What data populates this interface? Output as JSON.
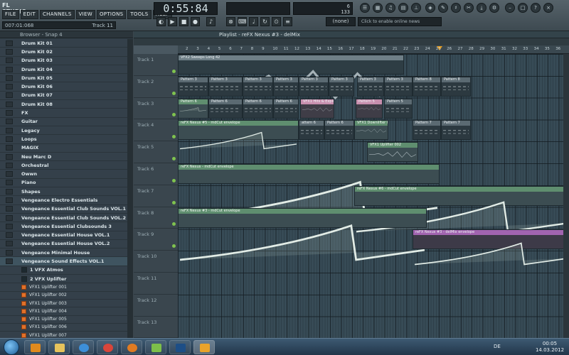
{
  "app": {
    "logo": "FL STUDIO",
    "menu": [
      "FILE",
      "EDIT",
      "CHANNELS",
      "VIEW",
      "OPTIONS",
      "TOOLS",
      "HELP"
    ],
    "hint_time": "007:01:068",
    "hint_track": "Track 11",
    "clock": "0:55:84",
    "cpu_line1": "6",
    "cpu_line2": "133",
    "snap_value": "(none)",
    "online_news": "Click to enable online news"
  },
  "browser": {
    "title": "Browser - Snap 4",
    "folders": [
      {
        "label": "Drum Kit 01"
      },
      {
        "label": "Drum Kit 02"
      },
      {
        "label": "Drum Kit 03"
      },
      {
        "label": "Drum Kit 04"
      },
      {
        "label": "Drum Kit 05"
      },
      {
        "label": "Drum Kit 06"
      },
      {
        "label": "Drum Kit 07"
      },
      {
        "label": "Drum Kit 08"
      },
      {
        "label": "FX"
      },
      {
        "label": "Guitar"
      },
      {
        "label": "Legacy"
      },
      {
        "label": "Loops"
      },
      {
        "label": "MAGIX"
      },
      {
        "label": "Neu Marc D"
      },
      {
        "label": "Orchestral"
      },
      {
        "label": "Owwn"
      },
      {
        "label": "Piano"
      },
      {
        "label": "Shapes"
      },
      {
        "label": "Vengeance Electro Essentials"
      },
      {
        "label": "Vengeance Essential Club Sounds VOL.1"
      },
      {
        "label": "Vengeance Essential Club Sounds VOL.2"
      },
      {
        "label": "Vengeance Essential Clubsounds 3"
      },
      {
        "label": "Vengeance Essential House VOL.1"
      },
      {
        "label": "Vengeance Essential House VOL.2"
      },
      {
        "label": "Vengeance Minimal House"
      },
      {
        "label": "Vengeance Sound Effects VOL.1"
      }
    ],
    "subfolders": [
      "1 VFX Atmos",
      "2 VFX Uplifter"
    ],
    "files": [
      "VFX1 Uplifter 001",
      "VFX1 Uplifter 002",
      "VFX1 Uplifter 003",
      "VFX1 Uplifter 004",
      "VFX1 Uplifter 005",
      "VFX1 Uplifter 006",
      "VFX1 Uplifter 007"
    ]
  },
  "playlist": {
    "title": "Playlist - reFX Nexus #3 - delMix",
    "bars": [
      "2",
      "3",
      "4",
      "5",
      "6",
      "7",
      "8",
      "9",
      "10",
      "11",
      "12",
      "13",
      "14",
      "15",
      "16",
      "17",
      "18",
      "19",
      "20",
      "21",
      "22",
      "23",
      "24",
      "25",
      "26",
      "27",
      "28",
      "29",
      "30",
      "31",
      "32",
      "33",
      "34",
      "35",
      "36"
    ],
    "tracks": [
      "Track 1",
      "Track 2",
      "Track 3",
      "Track 4",
      "Track 5",
      "Track 6",
      "Track 7",
      "Track 8",
      "Track 9",
      "Track 10",
      "Track 11",
      "Track 12",
      "Track 13"
    ],
    "clips": [
      {
        "label": "VFX2 Sweeps Long 42",
        "kind": "aud"
      },
      {
        "label": "Pattern 3",
        "kind": "pat"
      },
      {
        "label": "Pattern 3",
        "kind": "pat"
      },
      {
        "label": "Pattern 3",
        "kind": "pat"
      },
      {
        "label": "Pattern 3",
        "kind": "pat"
      },
      {
        "label": "Pattern 3",
        "kind": "pat"
      },
      {
        "label": "Pattern 3",
        "kind": "pat"
      },
      {
        "label": "Pattern 3",
        "kind": "pat"
      },
      {
        "label": "Pattern 3",
        "kind": "pat"
      },
      {
        "label": "Pattern 8",
        "kind": "pat"
      },
      {
        "label": "Pattern 8",
        "kind": "pat"
      },
      {
        "label": "Pattern 6",
        "kind": "env"
      },
      {
        "label": "Pattern 6",
        "kind": "pat"
      },
      {
        "label": "Pattern 6",
        "kind": "pat"
      },
      {
        "label": "Pattern 6",
        "kind": "pat"
      },
      {
        "label": "VFX1 Hits & Explod...",
        "kind": "pink"
      },
      {
        "label": "Pattern 5",
        "kind": "pink"
      },
      {
        "label": "Pattern 5",
        "kind": "pat"
      },
      {
        "label": "reFX Nexus #5 - mdCut envelope",
        "kind": "env"
      },
      {
        "label": "attern 6",
        "kind": "pat"
      },
      {
        "label": "Pattern 6",
        "kind": "pat"
      },
      {
        "label": "VFX1 Downlifter 0...",
        "kind": "env"
      },
      {
        "label": "Pattern 7",
        "kind": "pat"
      },
      {
        "label": "Pattern 7",
        "kind": "pat"
      },
      {
        "label": "VFX1 Uplifter 002",
        "kind": "env"
      },
      {
        "label": "reFX Nexus - mdCut envelope",
        "kind": "env"
      },
      {
        "label": "reFX Nexus #6 - mdCut envelope",
        "kind": "env"
      },
      {
        "label": "reFX Nexus #3 - mdCut envelope",
        "kind": "env"
      },
      {
        "label": "reFX Nexus #3 - delMix envelope",
        "kind": "purple"
      }
    ]
  },
  "taskbar": {
    "language": "DE",
    "time": "00:05",
    "date": "14.03.2012"
  }
}
